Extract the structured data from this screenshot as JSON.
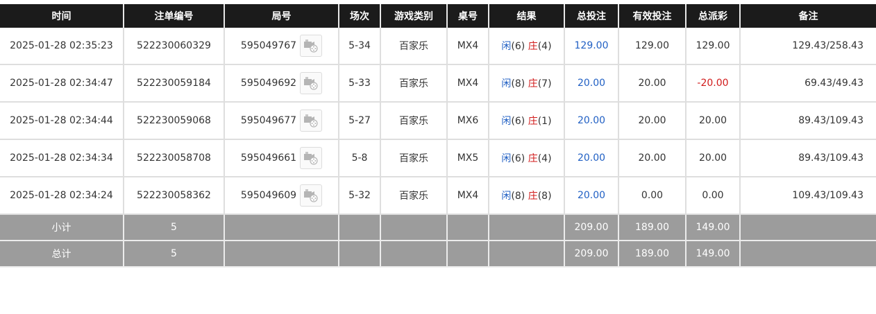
{
  "headers": [
    "时间",
    "注单编号",
    "局号",
    "场次",
    "游戏类别",
    "桌号",
    "结果",
    "总投注",
    "有效投注",
    "总派彩",
    "备注"
  ],
  "rows": [
    {
      "time": "2025-01-28 02:35:23",
      "bet_no": "522230060329",
      "game_no": "595049767",
      "round": "5-34",
      "game_type": "百家乐",
      "table": "MX4",
      "result": {
        "player_label": "闲",
        "player_val": "(6)",
        "banker_label": "庄",
        "banker_val": "(4)"
      },
      "total_bet": "129.00",
      "valid_bet": "129.00",
      "payout": "129.00",
      "payout_negative": false,
      "remark": "129.43/258.43"
    },
    {
      "time": "2025-01-28 02:34:47",
      "bet_no": "522230059184",
      "game_no": "595049692",
      "round": "5-33",
      "game_type": "百家乐",
      "table": "MX4",
      "result": {
        "player_label": "闲",
        "player_val": "(8)",
        "banker_label": "庄",
        "banker_val": "(7)"
      },
      "total_bet": "20.00",
      "valid_bet": "20.00",
      "payout": "-20.00",
      "payout_negative": true,
      "remark": "69.43/49.43"
    },
    {
      "time": "2025-01-28 02:34:44",
      "bet_no": "522230059068",
      "game_no": "595049677",
      "round": "5-27",
      "game_type": "百家乐",
      "table": "MX6",
      "result": {
        "player_label": "闲",
        "player_val": "(6)",
        "banker_label": "庄",
        "banker_val": "(1)"
      },
      "total_bet": "20.00",
      "valid_bet": "20.00",
      "payout": "20.00",
      "payout_negative": false,
      "remark": "89.43/109.43"
    },
    {
      "time": "2025-01-28 02:34:34",
      "bet_no": "522230058708",
      "game_no": "595049661",
      "round": "5-8",
      "game_type": "百家乐",
      "table": "MX5",
      "result": {
        "player_label": "闲",
        "player_val": "(6)",
        "banker_label": "庄",
        "banker_val": "(4)"
      },
      "total_bet": "20.00",
      "valid_bet": "20.00",
      "payout": "20.00",
      "payout_negative": false,
      "remark": "89.43/109.43"
    },
    {
      "time": "2025-01-28 02:34:24",
      "bet_no": "522230058362",
      "game_no": "595049609",
      "round": "5-32",
      "game_type": "百家乐",
      "table": "MX4",
      "result": {
        "player_label": "闲",
        "player_val": "(8)",
        "banker_label": "庄",
        "banker_val": "(8)"
      },
      "total_bet": "20.00",
      "valid_bet": "0.00",
      "payout": "0.00",
      "payout_negative": false,
      "remark": "109.43/109.43"
    }
  ],
  "subtotal": {
    "label": "小计",
    "count": "5",
    "total_bet": "209.00",
    "valid_bet": "189.00",
    "payout": "149.00"
  },
  "total": {
    "label": "总计",
    "count": "5",
    "total_bet": "209.00",
    "valid_bet": "189.00",
    "payout": "149.00"
  },
  "colors": {
    "header_bg": "#1b1b1b",
    "footer_bg": "#9c9c9c",
    "link_blue": "#2160c4",
    "negative_red": "#d11a1a"
  },
  "icons": {
    "replay": "video-replay-icon"
  }
}
